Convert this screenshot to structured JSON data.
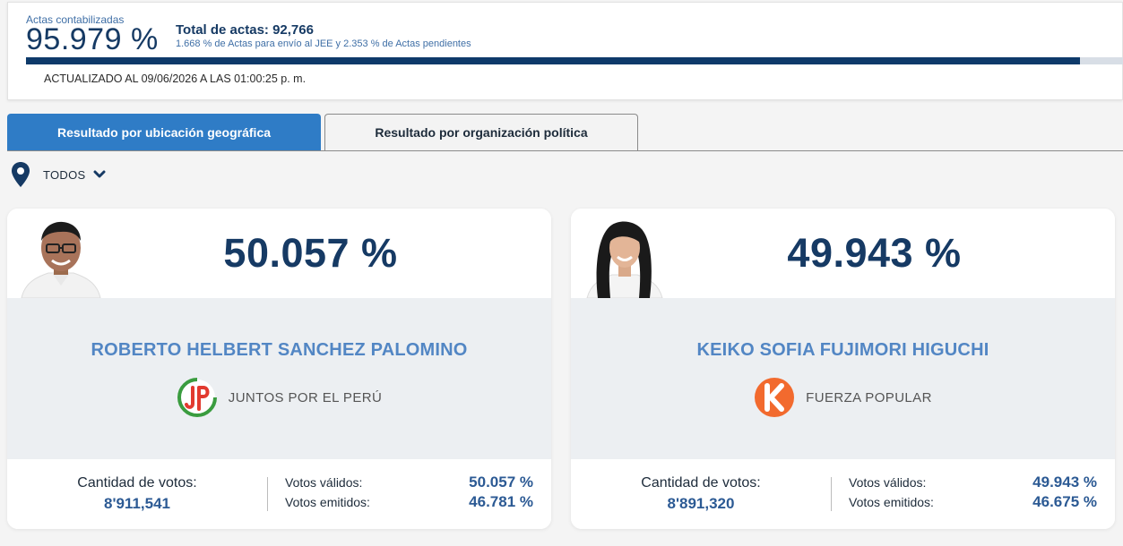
{
  "summary": {
    "actas_label": "Actas contabilizadas",
    "actas_pct": "95.979 %",
    "actas_progress": 0.95979,
    "total_actas": "Total de actas: 92,766",
    "total_sub": "1.668 % de Actas para envío al JEE y 2.353 % de Actas pendientes",
    "updated": "ACTUALIZADO AL 09/06/2026 A LAS 01:00:25 p. m."
  },
  "tabs": [
    {
      "label": "Resultado por ubicación geográfica",
      "active": true
    },
    {
      "label": "Resultado por organización política",
      "active": false
    }
  ],
  "filter": {
    "label": "TODOS",
    "icon": "location-pin-icon"
  },
  "candidates": [
    {
      "pct": "50.057 %",
      "name": "ROBERTO HELBERT SANCHEZ PALOMINO",
      "party": "JUNTOS POR EL PERÚ",
      "votes_label": "Cantidad de votos:",
      "votes": "8'911,541",
      "valid_label": "Votos válidos:",
      "valid_pct": "50.057 %",
      "emitted_label": "Votos emitidos:",
      "emitted_pct": "46.781 %"
    },
    {
      "pct": "49.943 %",
      "name": "KEIKO SOFIA FUJIMORI HIGUCHI",
      "party": "FUERZA POPULAR",
      "votes_label": "Cantidad de votos:",
      "votes": "8'891,320",
      "valid_label": "Votos válidos:",
      "valid_pct": "49.943 %",
      "emitted_label": "Votos emitidos:",
      "emitted_pct": "46.675 %"
    }
  ],
  "colors": {
    "navy": "#163a64",
    "accent_blue": "#2f7cc6",
    "name_blue": "#5286c4",
    "jp_green": "#3a9c3f",
    "jp_red": "#e23a2f",
    "fp_orange": "#f26a2e"
  }
}
